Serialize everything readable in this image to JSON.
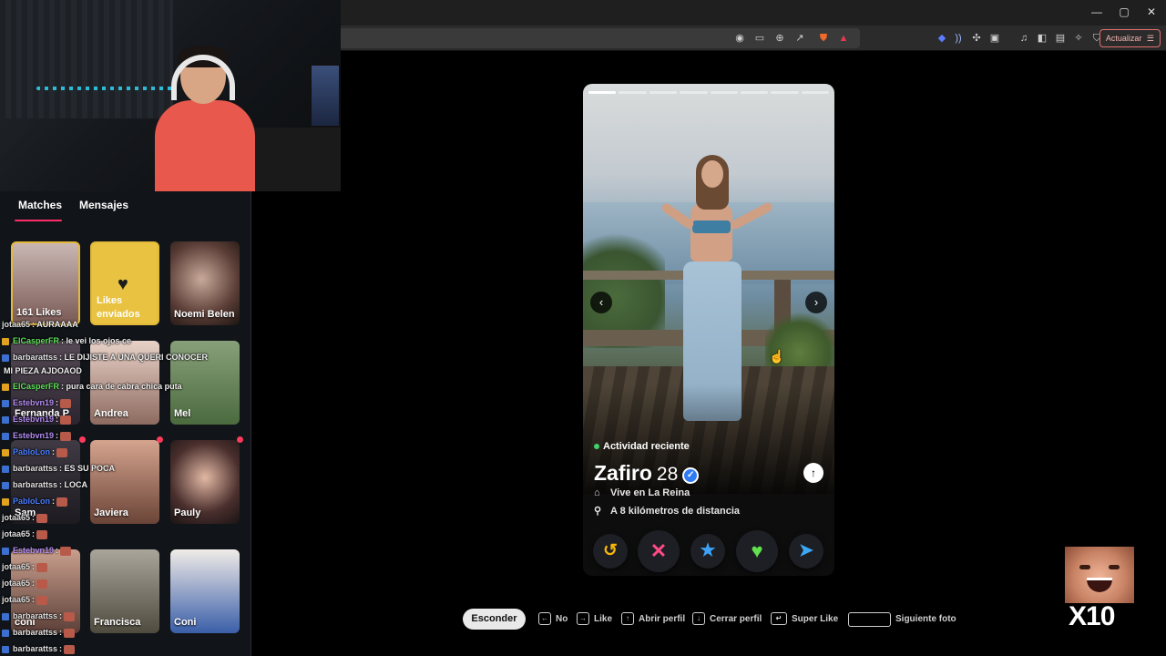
{
  "browser": {
    "update_label": "Actualizar",
    "window_controls": [
      "—",
      "▢",
      "✕"
    ],
    "toolbar_icons": [
      "location-icon",
      "cast-icon",
      "zoom-icon",
      "share-icon",
      "brave-shield-icon",
      "brave-rewards-icon",
      "extension-icon",
      "audio-icon",
      "extensions-icon",
      "media-icon",
      "music-icon",
      "sidebar-icon",
      "wallet-icon",
      "leo-icon",
      "vpn-icon",
      "menu-icon"
    ]
  },
  "sidebar": {
    "tabs": [
      {
        "label": "Matches",
        "active": true
      },
      {
        "label": "Mensajes",
        "active": false
      }
    ],
    "likes_count": "161 Likes",
    "likes_sent": "Likes enviados",
    "matches": [
      {
        "name": "Noemi Belen"
      },
      {
        "name": "Fernanda P"
      },
      {
        "name": "Andrea"
      },
      {
        "name": "Mel"
      },
      {
        "name": "Sam"
      },
      {
        "name": "Javiera"
      },
      {
        "name": "Pauly"
      },
      {
        "name": "coni"
      },
      {
        "name": "Francisca"
      },
      {
        "name": "Coni"
      }
    ]
  },
  "chat": [
    {
      "user": "jotaa65",
      "text": ": AURAAAA",
      "color": "#e0e0e0",
      "badge": false
    },
    {
      "user": "ElCasperFR",
      "text": ": le vei los ojos ce",
      "color": "#5fe05a",
      "badge": true,
      "gold": true
    },
    {
      "user": "barbarattss",
      "text": ": LE DIJISTE A UNA QUERI CONOCER",
      "color": "#e0e0e0",
      "badge": true
    },
    {
      "user": "",
      "text": "MI PIEZA AJDOAOD",
      "color": "#e0e0e0",
      "badge": false
    },
    {
      "user": "ElCasperFR",
      "text": ": pura cara de cabra chica puta",
      "color": "#5fe05a",
      "badge": true,
      "gold": true
    },
    {
      "user": "Estebvn19",
      "text": ":",
      "color": "#b48cf2",
      "badge": true
    },
    {
      "user": "Estebvn19",
      "text": ":",
      "color": "#b48cf2",
      "badge": true
    },
    {
      "user": "Estebvn19",
      "text": ":",
      "color": "#b48cf2",
      "badge": true
    },
    {
      "user": "PabloLon",
      "text": ":",
      "color": "#4a7dff",
      "badge": true,
      "gold": true
    },
    {
      "user": "barbarattss",
      "text": ": ES SU POCA",
      "color": "#e0e0e0",
      "badge": true
    },
    {
      "user": "barbarattss",
      "text": ": LOCA",
      "color": "#e0e0e0",
      "badge": true
    },
    {
      "user": "PabloLon",
      "text": ":",
      "color": "#4a7dff",
      "badge": true,
      "gold": true
    },
    {
      "user": "jotaa65",
      "text": ":",
      "color": "#e0e0e0",
      "badge": false
    },
    {
      "user": "jotaa65",
      "text": ":",
      "color": "#e0e0e0",
      "badge": false
    },
    {
      "user": "Estebvn19",
      "text": ":",
      "color": "#b48cf2",
      "badge": true
    },
    {
      "user": "jotaa65",
      "text": ":",
      "color": "#e0e0e0",
      "badge": false
    },
    {
      "user": "jotaa65",
      "text": ":",
      "color": "#e0e0e0",
      "badge": false
    },
    {
      "user": "jotaa65",
      "text": ":",
      "color": "#e0e0e0",
      "badge": false
    },
    {
      "user": "barbarattss",
      "text": ":",
      "color": "#e0e0e0",
      "badge": true
    },
    {
      "user": "barbarattss",
      "text": ":",
      "color": "#e0e0e0",
      "badge": true
    },
    {
      "user": "barbarattss",
      "text": ":",
      "color": "#e0e0e0",
      "badge": true
    }
  ],
  "profile": {
    "activity": "Actividad reciente",
    "name": "Zafiro",
    "age": "28",
    "lives_in": "Vive en La Reina",
    "distance": "A 8 kilómetros de distancia",
    "photo_count": 8,
    "current_photo": 1
  },
  "actions": [
    {
      "name": "rewind",
      "glyph": "↺",
      "color": "#f5b50a"
    },
    {
      "name": "nope",
      "glyph": "✕",
      "color": "#ff4a86"
    },
    {
      "name": "super-like",
      "glyph": "★",
      "color": "#3ea3f7"
    },
    {
      "name": "like",
      "glyph": "♥",
      "color": "#62e04d"
    },
    {
      "name": "boost",
      "glyph": "➤",
      "color": "#3ba8f5"
    }
  ],
  "hints": {
    "hide_label": "Esconder",
    "no": "No",
    "like": "Like",
    "open_profile": "Abrir perfil",
    "close_profile": "Cerrar perfil",
    "super_like": "Super Like",
    "next_photo": "Siguiente foto"
  },
  "overlay": {
    "multiplier": "X10"
  }
}
